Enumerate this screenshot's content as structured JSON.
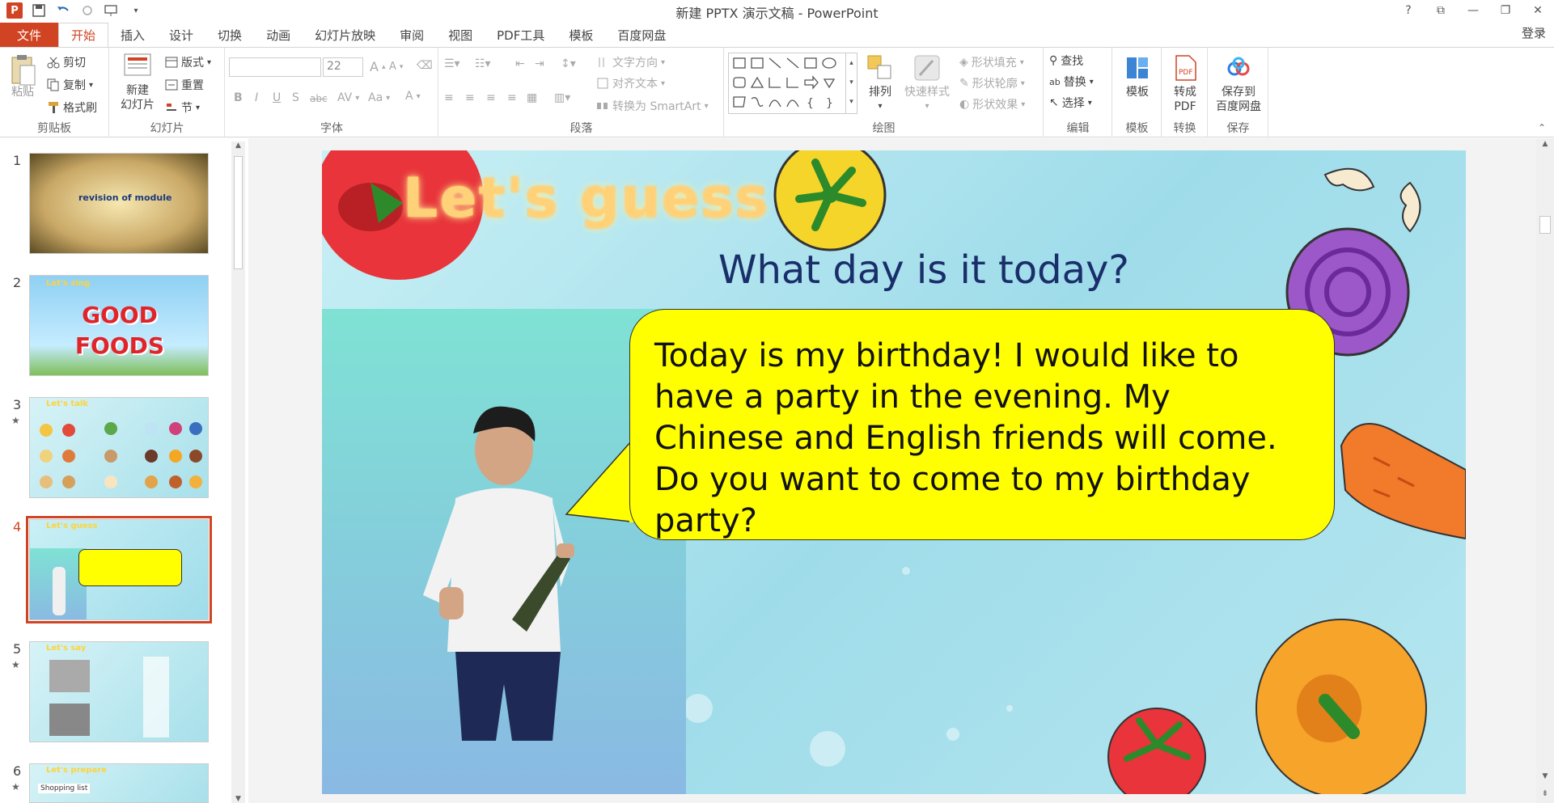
{
  "window": {
    "title": "新建 PPTX 演示文稿 - PowerPoint",
    "controls": [
      "?",
      "⧉",
      "—",
      "❐",
      "✕"
    ]
  },
  "tabs": [
    "文件",
    "开始",
    "插入",
    "设计",
    "切换",
    "动画",
    "幻灯片放映",
    "审阅",
    "视图",
    "PDF工具",
    "模板",
    "百度网盘"
  ],
  "login": "登录",
  "ribbon": {
    "clipboard": {
      "paste": "粘贴",
      "cut": "剪切",
      "copy": "复制",
      "format_painter": "格式刷",
      "label": "剪贴板"
    },
    "slides": {
      "new_slide": "新建\n幻灯片",
      "layout": "版式",
      "reset": "重置",
      "section": "节",
      "label": "幻灯片"
    },
    "font": {
      "size": "22",
      "label": "字体",
      "bold": "B",
      "italic": "I",
      "underline": "U",
      "shadow": "S",
      "strike": "abc",
      "spacing": "AV",
      "case": "Aa",
      "color": "A",
      "grow": "A",
      "shrink": "A"
    },
    "paragraph": {
      "text_direction": "文字方向",
      "align_text": "对齐文本",
      "smartart": "转换为 SmartArt",
      "label": "段落"
    },
    "drawing": {
      "arrange": "排列",
      "quick_styles": "快速样式",
      "fill": "形状填充",
      "outline": "形状轮廓",
      "effects": "形状效果",
      "label": "绘图"
    },
    "editing": {
      "find": "查找",
      "replace": "替换",
      "select": "选择",
      "label": "编辑"
    },
    "template": {
      "button": "模板",
      "label": "模板"
    },
    "convert": {
      "button": "转成\nPDF",
      "label": "转换"
    },
    "save": {
      "button": "保存到\n百度网盘",
      "label": "保存"
    }
  },
  "thumbnails": [
    {
      "num": "1",
      "star": false,
      "caption": "revision of module"
    },
    {
      "num": "2",
      "star": false,
      "caption": "GOOD FOODS",
      "tag": "Let's sing"
    },
    {
      "num": "3",
      "star": true,
      "tag": "Let's talk"
    },
    {
      "num": "4",
      "star": false,
      "tag": "Let's guess",
      "selected": true
    },
    {
      "num": "5",
      "star": true,
      "tag": "Let's say"
    },
    {
      "num": "6",
      "star": true,
      "tag": "Let's prepare",
      "caption": "Shopping list"
    }
  ],
  "slide": {
    "title": "Let's guess",
    "question": "What day is it today?",
    "bubble": "Today is my birthday! I would like to have a party in the evening. My Chinese and English friends will come. Do you want to come to my birthday party?"
  },
  "colors": {
    "accent": "#d04423",
    "bubble": "#ffff00",
    "question": "#1a2e6a"
  }
}
